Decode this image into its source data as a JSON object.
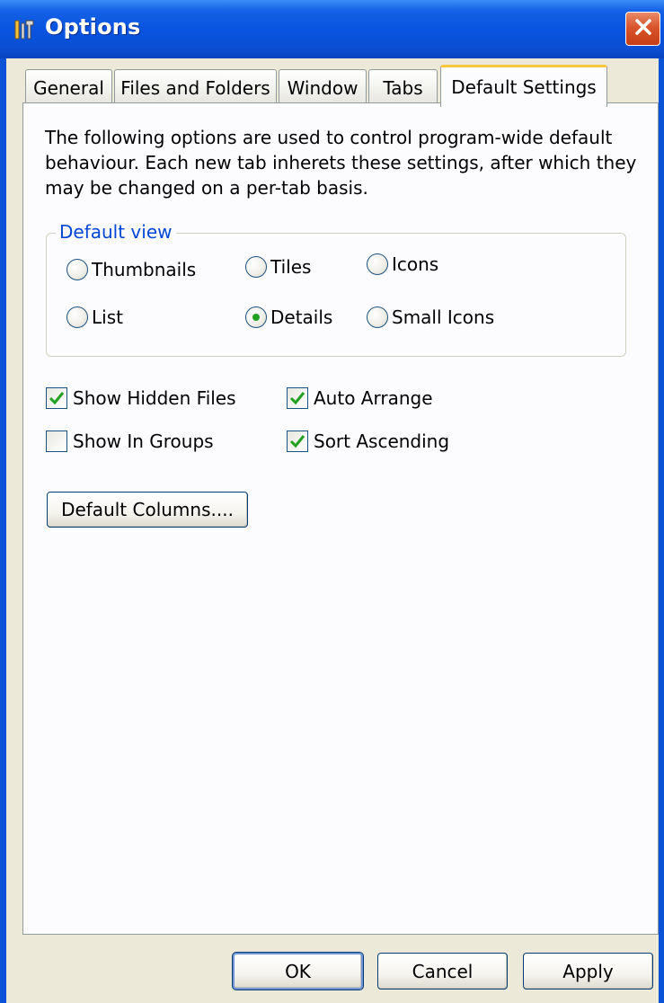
{
  "window": {
    "title": "Options",
    "icon": "options-tools-icon",
    "close_icon": "close-icon"
  },
  "tabs": [
    {
      "label": "General",
      "active": false
    },
    {
      "label": "Files and Folders",
      "active": false
    },
    {
      "label": "Window",
      "active": false
    },
    {
      "label": "Tabs",
      "active": false
    },
    {
      "label": "Default Settings",
      "active": true
    }
  ],
  "panel": {
    "description": "The following options are used to control program-wide default behaviour. Each new tab inherets these settings, after which they may be changed on a per-tab basis.",
    "default_view": {
      "label": "Default view",
      "options": [
        {
          "label": "Thumbnails",
          "checked": false
        },
        {
          "label": "Tiles",
          "checked": false
        },
        {
          "label": "Icons",
          "checked": false
        },
        {
          "label": "List",
          "checked": false
        },
        {
          "label": "Details",
          "checked": true
        },
        {
          "label": "Small Icons",
          "checked": false
        }
      ]
    },
    "checkboxes": [
      {
        "label": "Show Hidden Files",
        "checked": true
      },
      {
        "label": "Auto Arrange",
        "checked": true
      },
      {
        "label": "Show In Groups",
        "checked": false
      },
      {
        "label": "Sort Ascending",
        "checked": true
      }
    ],
    "default_columns_button": "Default Columns...."
  },
  "buttons": {
    "ok": "OK",
    "cancel": "Cancel",
    "apply": "Apply"
  },
  "colors": {
    "title_bar": "#0a53d6",
    "close_button": "#d9552b",
    "group_label": "#0046d5",
    "check_mark": "#21a121",
    "active_tab_highlight": "#ffc83c",
    "dialog_face": "#ece9d8"
  }
}
